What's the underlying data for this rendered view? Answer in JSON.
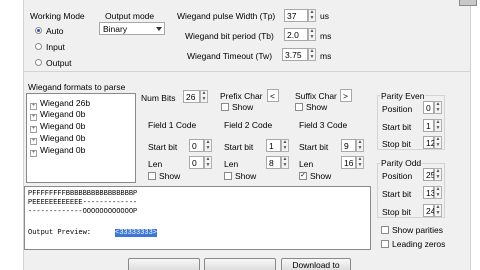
{
  "working_mode": {
    "title": "Working Mode",
    "options": [
      "Auto",
      "Input",
      "Output"
    ],
    "selected": 0
  },
  "output_mode": {
    "title": "Output mode",
    "value": "Binary"
  },
  "wiegand_timing": {
    "pulse_width_label": "Wiegand pulse Width (Tp)",
    "pulse_width_value": "37",
    "pulse_width_unit": "us",
    "bit_period_label": "Wiegand bit period (Tb)",
    "bit_period_value": "2.0",
    "bit_period_unit": "ms",
    "timeout_label": "Wiegand Timeout (Tw)",
    "timeout_value": "3.75",
    "timeout_unit": "ms"
  },
  "formats": {
    "title": "Wiegand formats to parse",
    "items": [
      "Wiegand 26b",
      "Wiegand 0b",
      "Wiegand 0b",
      "Wiegand 0b",
      "Wiegand 0b"
    ]
  },
  "num_bits": {
    "label": "Num Bits",
    "value": "26"
  },
  "prefix": {
    "label": "Prefix Char",
    "value": "<",
    "show_label": "Show"
  },
  "suffix": {
    "label": "Suffix Char",
    "value": ">",
    "show_label": "Show"
  },
  "field1": {
    "title": "Field 1 Code",
    "start_label": "Start bit",
    "start_value": "0",
    "len_label": "Len",
    "len_value": "0",
    "show_label": "Show"
  },
  "field2": {
    "title": "Field 2 Code",
    "start_label": "Start bit",
    "start_value": "1",
    "len_label": "Len",
    "len_value": "8",
    "show_label": "Show"
  },
  "field3": {
    "title": "Field 3 Code",
    "start_label": "Start bit",
    "start_value": "9",
    "len_label": "Len",
    "len_value": "16",
    "show_label": "Show"
  },
  "parity_even": {
    "title": "Parity Even",
    "position_label": "Position",
    "position_value": "0",
    "start_label": "Start bit",
    "start_value": "1",
    "stop_label": "Stop bit",
    "stop_value": "12"
  },
  "parity_odd": {
    "title": "Parity Odd",
    "position_label": "Position",
    "position_value": "25",
    "start_label": "Start bit",
    "start_value": "13",
    "stop_label": "Stop bit",
    "stop_value": "24"
  },
  "options": {
    "show_parities": "Show parities",
    "leading_zeros": "Leading zeros"
  },
  "preview": {
    "line1": "PFFFFFFFFBBBBBBBBBBBBBBBBP",
    "line2": "PEEEEEEEEEEEE-------------",
    "line3": "-------------OOOOOOOOOOOOP",
    "output_label": "Output Preview:",
    "output_value": "<33333333>"
  },
  "buttons": {
    "download": "Download to"
  }
}
